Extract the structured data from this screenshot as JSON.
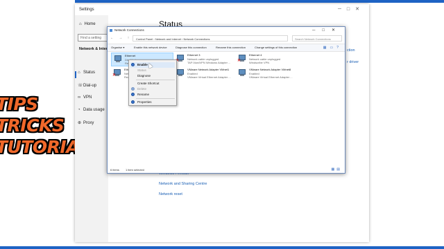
{
  "settings": {
    "title": "Settings",
    "home_label": "Home",
    "search_placeholder": "Find a setting",
    "section": "Network & Internet",
    "nav": [
      {
        "label": "Status",
        "icon": "globe-icon"
      },
      {
        "label": "Dial-up",
        "icon": "phone-icon"
      },
      {
        "label": "VPN",
        "icon": "vpn-icon"
      },
      {
        "label": "Data usage",
        "icon": "data-usage-icon"
      },
      {
        "label": "Proxy",
        "icon": "proxy-globe-icon"
      }
    ],
    "page_title": "Status",
    "partial_links": [
      "ction",
      "r driver"
    ],
    "links": [
      "Windows Firewall",
      "Network and Sharing Centre",
      "Network reset"
    ]
  },
  "network_connections": {
    "title": "Network Connections",
    "breadcrumb": [
      "Control Panel",
      "Network and Internet",
      "Network Connections"
    ],
    "search_placeholder": "Search Network Connections",
    "commands": [
      "Organise ▾",
      "Enable this network device",
      "Diagnose this connection",
      "Rename this connection",
      "Change settings of this connection"
    ],
    "adapters": [
      {
        "name": "Ethernet",
        "status": "Disabled",
        "device": "Realtek PCIe GbE Family Controller",
        "selected": true,
        "unplugged": false
      },
      {
        "name": "Ethernet 3",
        "status": "Network cable unplugged",
        "device": "TAP-NordVPN Windows Adapter ...",
        "selected": false,
        "unplugged": true
      },
      {
        "name": "Ethernet 4",
        "status": "Network cable unplugged",
        "device": "Windscribe VPN",
        "selected": false,
        "unplugged": true
      },
      {
        "name": "Eth",
        "status": "Net",
        "device": "Rea",
        "selected": false,
        "unplugged": true
      },
      {
        "name": "VMware Network Adapter VMnet1",
        "status": "Enabled",
        "device": "VMware Virtual Ethernet Adapter ...",
        "selected": false,
        "unplugged": false
      },
      {
        "name": "VMware Network Adapter VMnet8",
        "status": "Enabled",
        "device": "VMware Virtual Ethernet Adapter ...",
        "selected": false,
        "unplugged": false
      }
    ],
    "status_bar": {
      "items": "6 items",
      "selected": "1 item selected"
    }
  },
  "context_menu": {
    "items": [
      {
        "label": "Enable",
        "bold": true,
        "disabled": false,
        "shield": true
      },
      {
        "label": "Status",
        "bold": false,
        "disabled": true,
        "shield": false
      },
      {
        "label": "Diagnose",
        "bold": false,
        "disabled": false,
        "shield": false
      },
      {
        "label": "Create Shortcut",
        "bold": false,
        "disabled": false,
        "shield": false
      },
      {
        "label": "Delete",
        "bold": false,
        "disabled": true,
        "shield": true
      },
      {
        "label": "Rename",
        "bold": false,
        "disabled": false,
        "shield": true
      },
      {
        "label": "Properties",
        "bold": false,
        "disabled": false,
        "shield": true
      }
    ]
  },
  "overlay_text": [
    "TIPS",
    "TRICKS",
    "TUTORIALS"
  ],
  "colors": {
    "accent": "#1e63c4",
    "link": "#1a5fb4",
    "promo": "#f0682a",
    "selection": "#cce8ff"
  }
}
